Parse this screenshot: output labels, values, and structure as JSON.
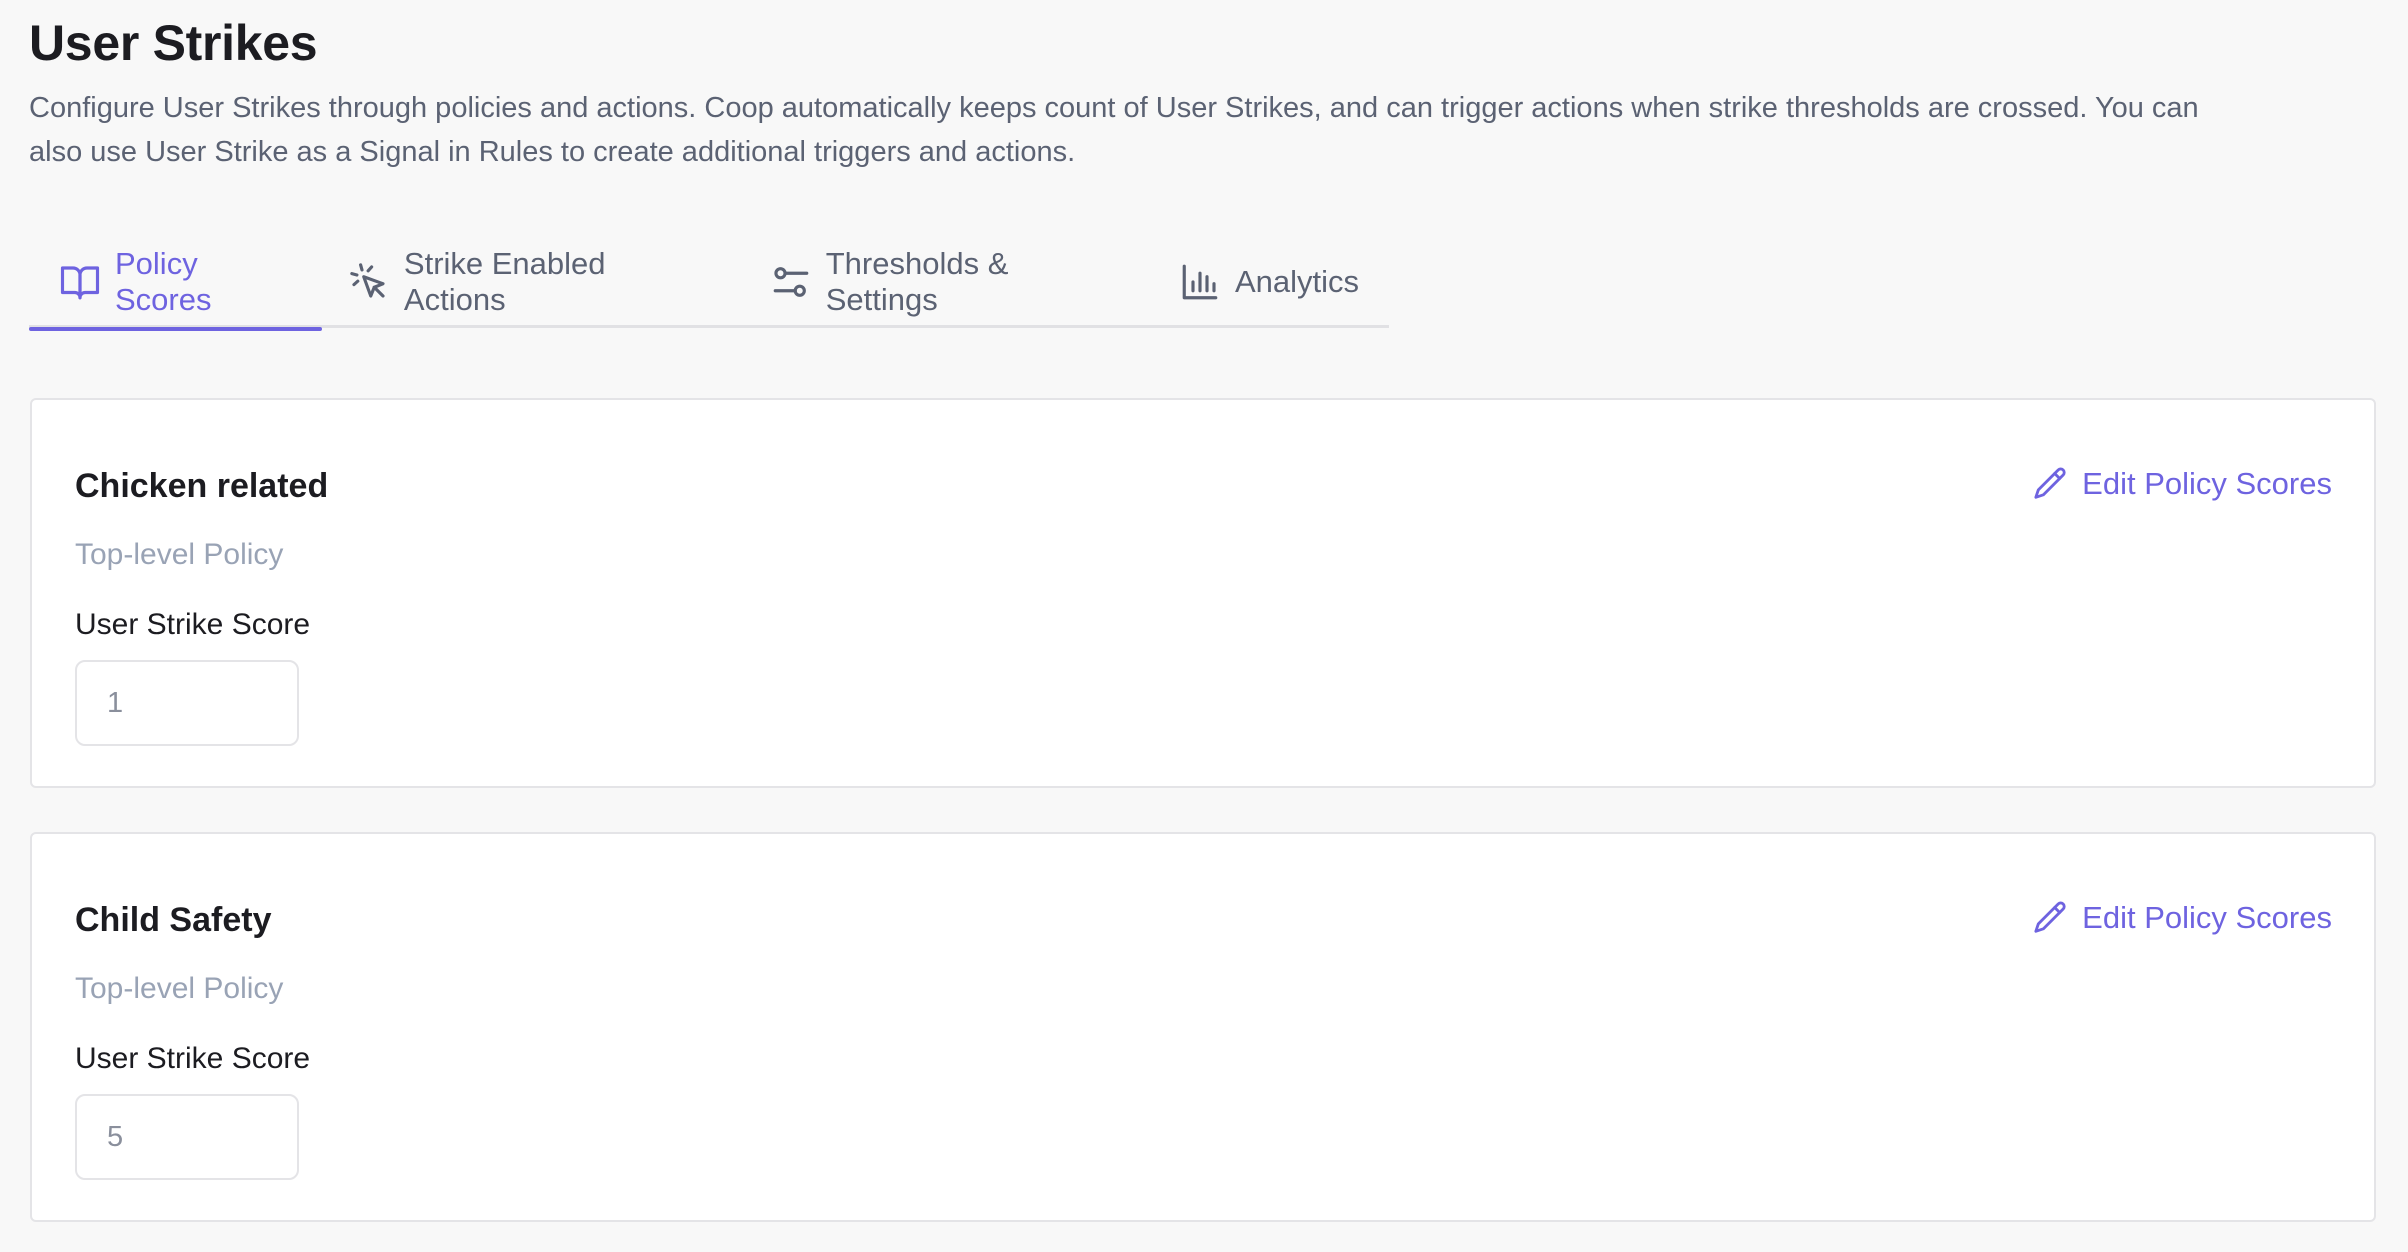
{
  "header": {
    "title": "User Strikes",
    "description": "Configure User Strikes through policies and actions. Coop automatically keeps count of User Strikes, and can trigger actions when strike thresholds are crossed. You can also use User Strike as a Signal in Rules to create additional triggers and actions."
  },
  "tabs": [
    {
      "label": "Policy Scores",
      "icon": "book-open-icon",
      "active": true
    },
    {
      "label": "Strike Enabled Actions",
      "icon": "cursor-click-icon",
      "active": false
    },
    {
      "label": "Thresholds & Settings",
      "icon": "sliders-icon",
      "active": false
    },
    {
      "label": "Analytics",
      "icon": "bar-chart-icon",
      "active": false
    }
  ],
  "policies": [
    {
      "name": "Chicken related",
      "type": "Top-level Policy",
      "score_label": "User Strike Score",
      "score": "1",
      "edit_label": "Edit Policy Scores"
    },
    {
      "name": "Child Safety",
      "type": "Top-level Policy",
      "score_label": "User Strike Score",
      "score": "5",
      "edit_label": "Edit Policy Scores"
    }
  ],
  "colors": {
    "accent": "#6e63e0",
    "muted_text": "#5b6273",
    "background": "#f8f8f8"
  }
}
